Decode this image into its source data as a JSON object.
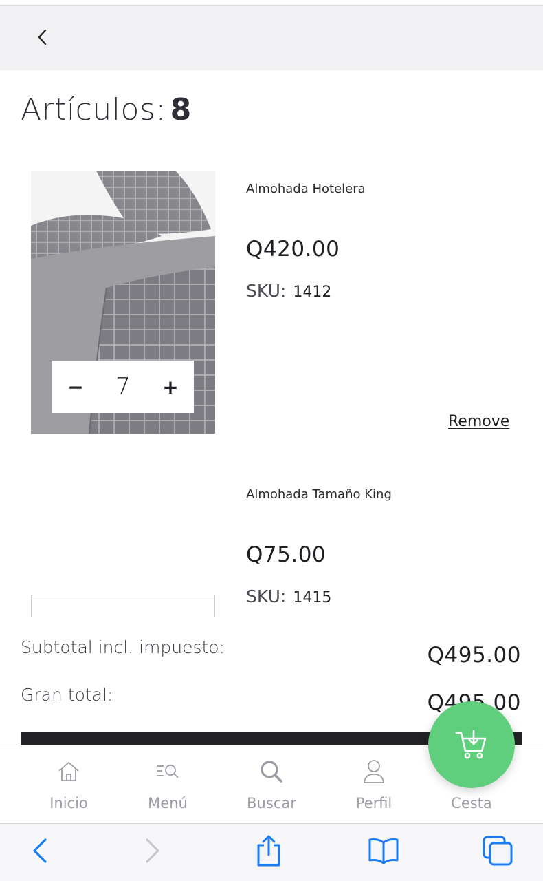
{
  "header": {
    "back_icon": "chevron-left-icon"
  },
  "cart": {
    "title": "Artículos:",
    "count": "8"
  },
  "items": [
    {
      "name": "Almohada Hotelera",
      "price": "Q420.00",
      "sku_label": "SKU:",
      "sku": "1412",
      "quantity": "7",
      "minus": "−",
      "plus": "+",
      "remove": "Remove"
    },
    {
      "name": "Almohada Tamaño King",
      "price": "Q75.00",
      "sku_label": "SKU:",
      "sku": "1415"
    }
  ],
  "totals": {
    "subtotal_label": "Subtotal incl. impuesto:",
    "subtotal_value": "Q495.00",
    "grand_label": "Gran total:",
    "grand_value": "Q495.00"
  },
  "tabbar": {
    "items": [
      {
        "label": "Inicio",
        "icon": "home-icon"
      },
      {
        "label": "Menú",
        "icon": "menu-search-icon"
      },
      {
        "label": "Buscar",
        "icon": "search-icon"
      },
      {
        "label": "Perfil",
        "icon": "user-icon"
      },
      {
        "label": "Cesta",
        "icon": "cart-icon"
      }
    ]
  },
  "colors": {
    "accent": "#5fce7d",
    "ios_blue": "#1a7cf5",
    "dark": "#232327"
  }
}
